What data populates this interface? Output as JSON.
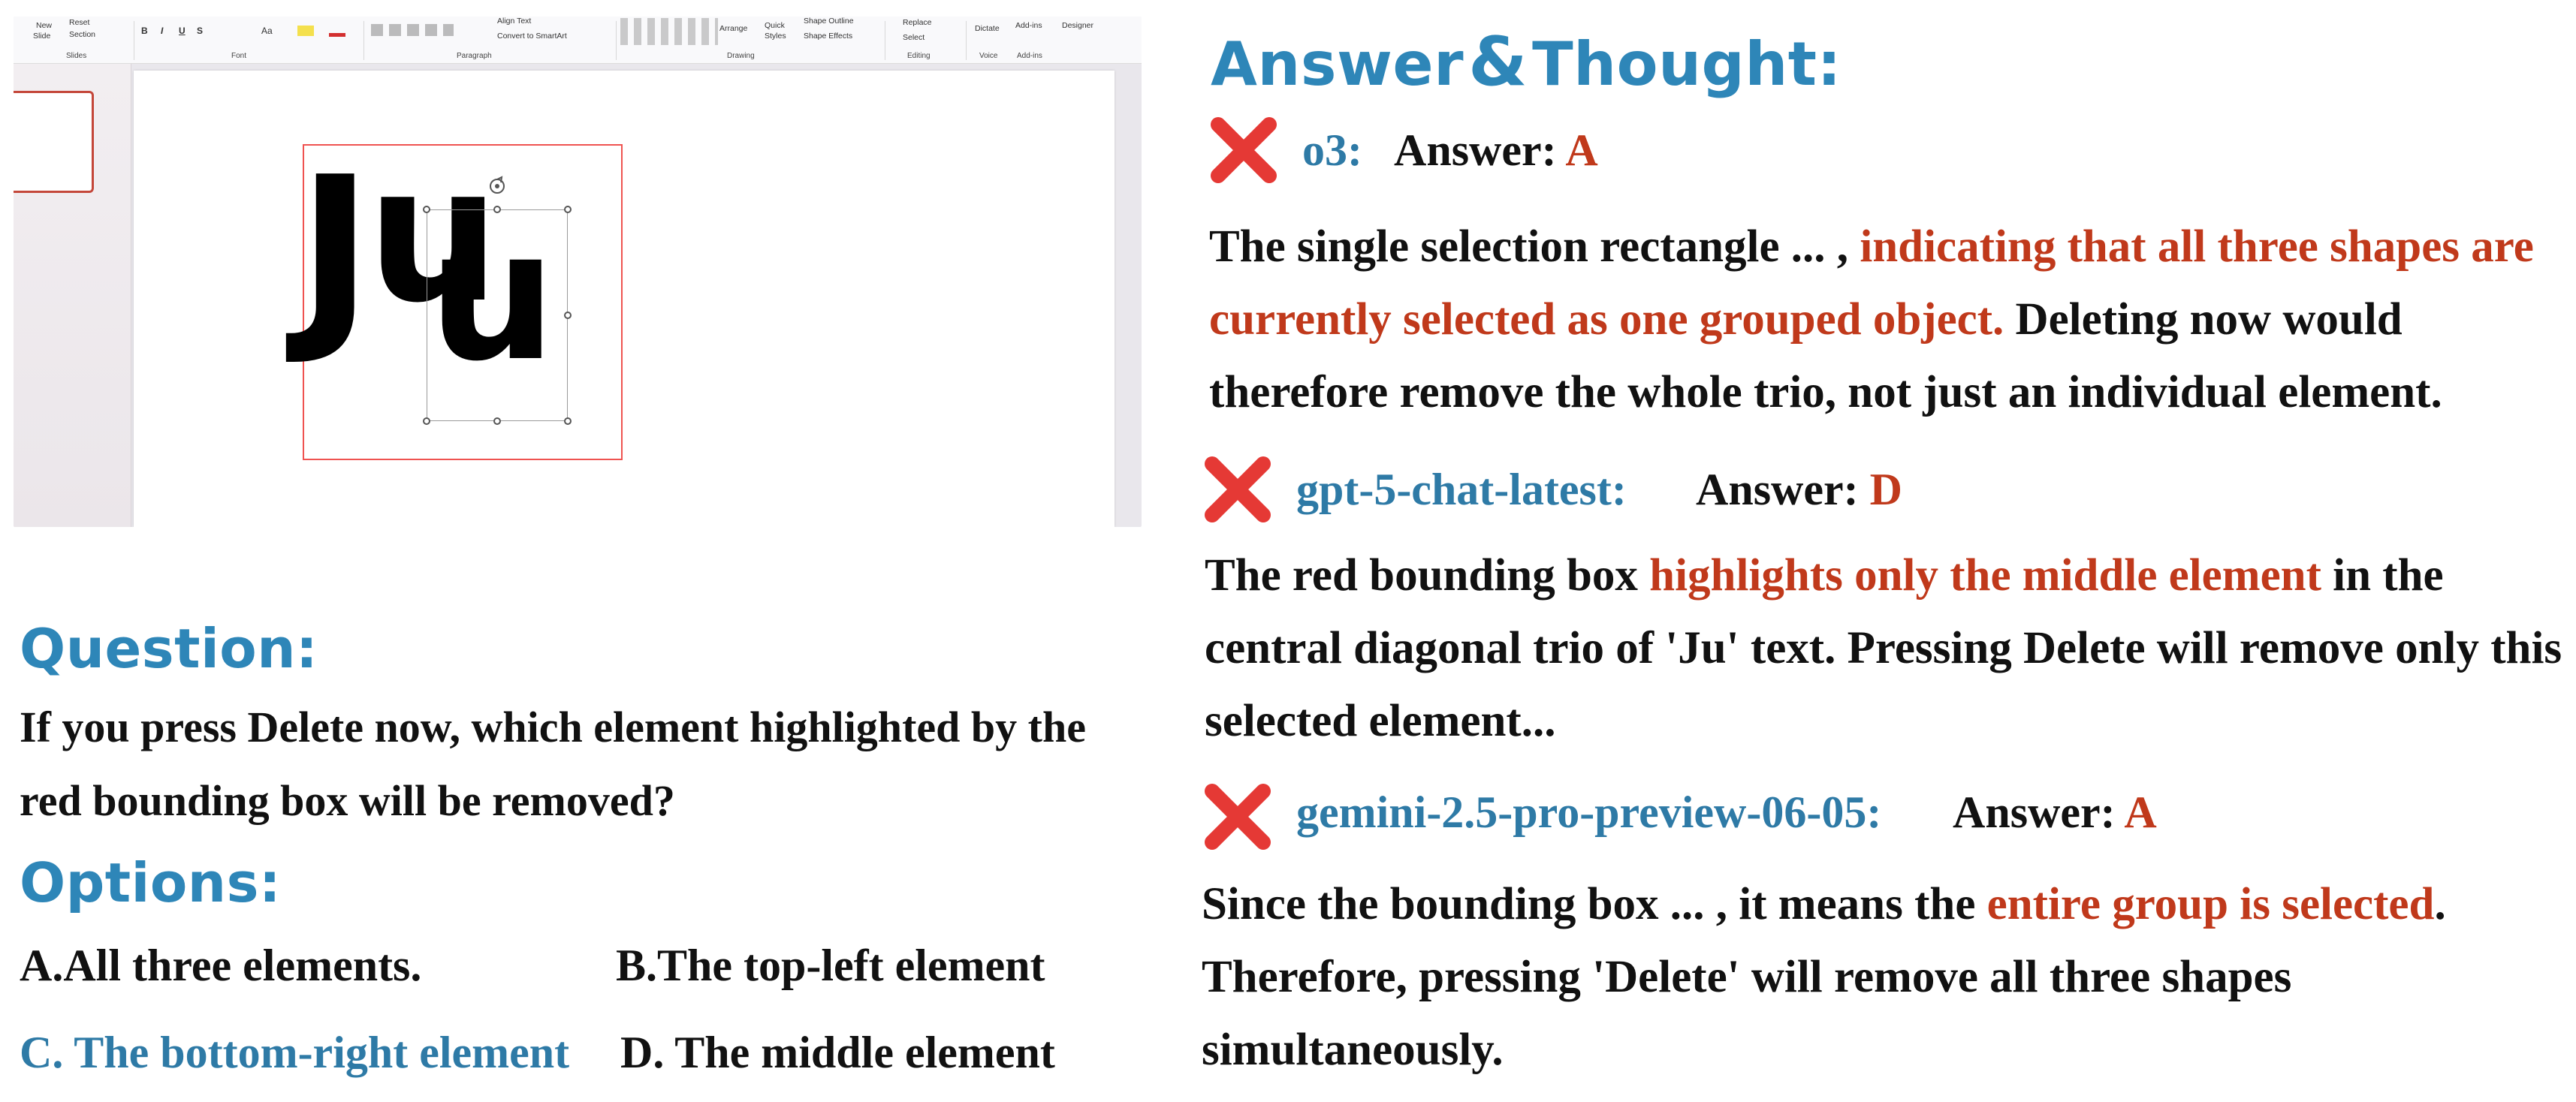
{
  "screenshot": {
    "ribbon": {
      "new_slide": "New",
      "new_slide2": "Slide",
      "reset": "Reset",
      "section": "Section",
      "slides_group": "Slides",
      "font_group": "Font",
      "paragraph_group": "Paragraph",
      "align_text": "Align Text",
      "convert_smartart": "Convert to SmartArt",
      "drawing_group": "Drawing",
      "arrange": "Arrange",
      "quick": "Quick",
      "styles": "Styles",
      "shape_outline": "Shape Outline",
      "shape_effects": "Shape Effects",
      "replace": "Replace",
      "select": "Select",
      "editing_group": "Editing",
      "dictate": "Dictate",
      "voice_group": "Voice",
      "addins": "Add-ins",
      "addins_group": "Add-ins",
      "designer": "Designer",
      "bold": "B",
      "italic": "I",
      "underline": "U",
      "strike": "S",
      "case": "Aa"
    },
    "slide_text": {
      "glyph_j": "J",
      "glyph_u1": "u",
      "glyph_u2": "u"
    }
  },
  "question": {
    "heading": "Question:",
    "text": "If you press Delete now, which element highlighted by the red bounding box will be removed?"
  },
  "options": {
    "heading": "Options:",
    "a": "A.All three elements.",
    "b": "B.The top-left element",
    "c": "C. The bottom-right element",
    "d": "D. The middle element"
  },
  "answer_heading": {
    "part1": "Answer",
    "amp": "&",
    "part2": "Thought:"
  },
  "answers": [
    {
      "model": "o3:",
      "answer_label": "Answer:",
      "answer_value": "A",
      "text_pre": "The single selection rectangle ... , ",
      "text_highlight": "indicating that all three shapes are currently selected as one grouped object.",
      "text_post": " Deleting now would therefore remove the whole trio, not just an individual element."
    },
    {
      "model": "gpt-5-chat-latest:",
      "answer_label": "Answer:",
      "answer_value": "D",
      "text_pre": "The red bounding box ",
      "text_highlight": "highlights only the middle element",
      "text_post": " in the central diagonal trio of 'Ju' text. Pressing Delete will remove only this selected element..."
    },
    {
      "model": "gemini-2.5-pro-preview-06-05:",
      "answer_label": "Answer:",
      "answer_value": "A",
      "text_pre": "Since the bounding box ... , it means the ",
      "text_highlight": "entire group is selected",
      "text_post": ". Therefore, pressing 'Delete' will remove all three shapes simultaneously."
    }
  ],
  "colors": {
    "heading_blue": "#2e86b8",
    "model_blue": "#2e7aa6",
    "highlight_red": "#c0391b",
    "x_mark_red": "#e53935",
    "bounding_box_red": "#ef5350"
  },
  "icons": [
    "x-mark-icon",
    "rotate-handle-icon"
  ]
}
